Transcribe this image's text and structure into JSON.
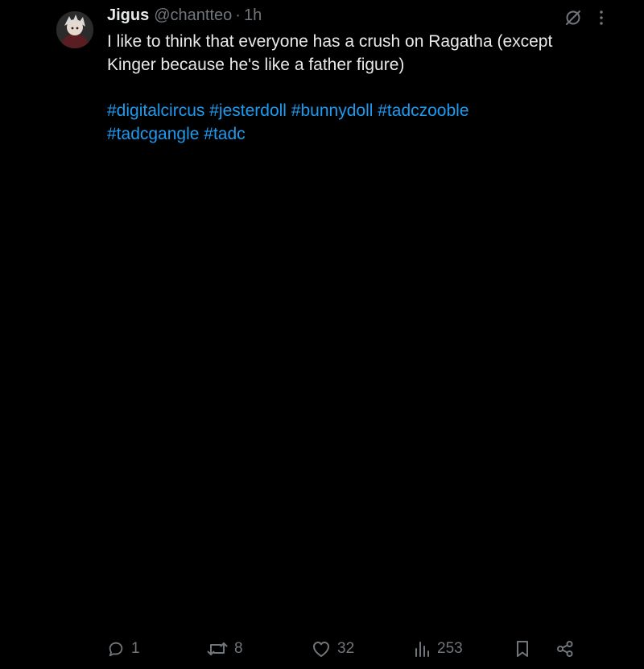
{
  "tweet": {
    "author_name": "Jigus",
    "handle": "@chantteo",
    "separator": "·",
    "time": "1h",
    "text_lines": [
      "I like to think that everyone has a crush on Ragatha (except",
      "Kinger because he's like a father figure)"
    ],
    "hashtags": [
      "#digitalcircus",
      "#jesterdoll",
      "#bunnydoll",
      "#tadczooble",
      "#tadcgangle",
      "#tadc"
    ],
    "icons": {
      "top_left": "grok-icon",
      "top_right": "more-icon"
    }
  },
  "actions": {
    "reply_count": "1",
    "retweet_count": "8",
    "like_count": "32",
    "views_count": "253"
  },
  "colors": {
    "background": "#000000",
    "text": "#e7e9ea",
    "muted": "#71767b",
    "link": "#1d9bf0"
  }
}
